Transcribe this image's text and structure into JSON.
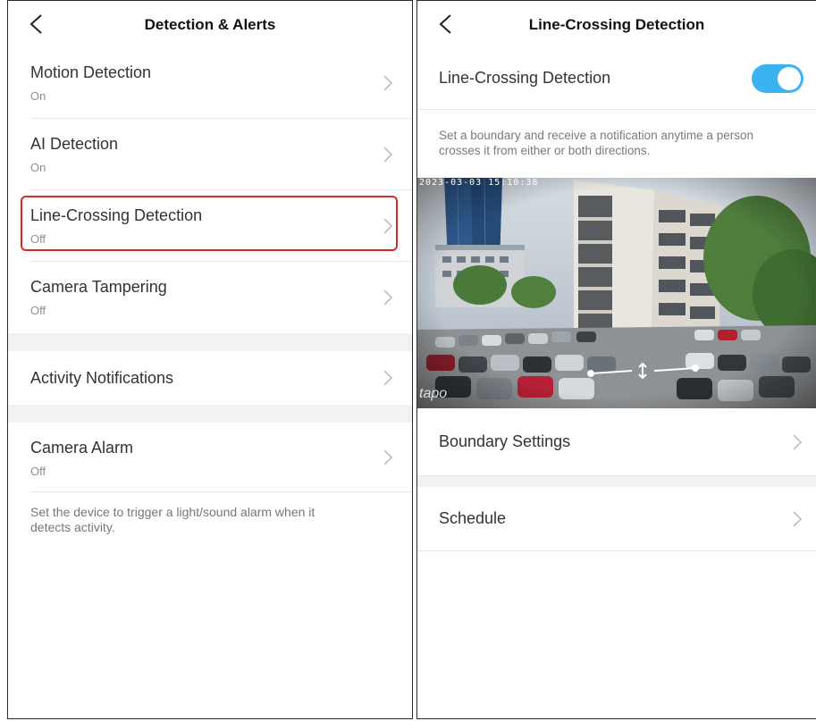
{
  "left_screen": {
    "title": "Detection & Alerts",
    "items": [
      {
        "label": "Motion Detection",
        "status": "On"
      },
      {
        "label": "AI Detection",
        "status": "On"
      },
      {
        "label": "Line-Crossing Detection",
        "status": "Off"
      },
      {
        "label": "Camera Tampering",
        "status": "Off"
      },
      {
        "label": "Activity Notifications"
      },
      {
        "label": "Camera Alarm",
        "status": "Off"
      }
    ],
    "alarm_note": "Set the device to trigger a light/sound alarm when it detects activity."
  },
  "right_screen": {
    "title": "Line-Crossing Detection",
    "toggle_label": "Line-Crossing Detection",
    "toggle_on": true,
    "description": "Set a boundary and receive a notification anytime a person crosses it from either or both directions.",
    "camera_timestamp": "2023-03-03 15:10:38",
    "camera_watermark": "tapo",
    "items": [
      {
        "label": "Boundary Settings"
      },
      {
        "label": "Schedule"
      }
    ]
  },
  "colors": {
    "toggle_accent": "#3ab4f0",
    "highlight": "#d62828"
  },
  "icons": [
    "back-icon",
    "chevron-right-icon",
    "toggle-switch",
    "boundary-handle-icon"
  ]
}
